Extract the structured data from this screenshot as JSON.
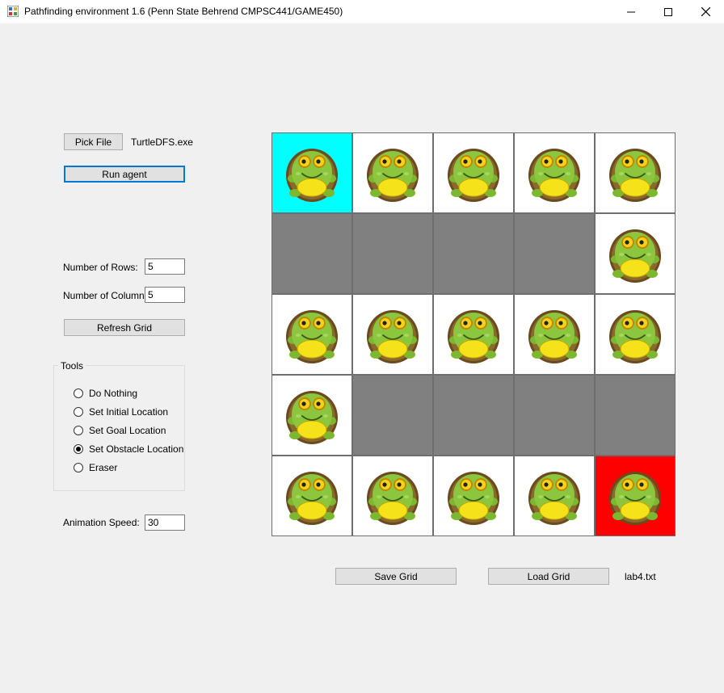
{
  "window": {
    "title": "Pathfinding environment 1.6 (Penn State Behrend CMPSC441/GAME450)"
  },
  "controls": {
    "pick_file_label": "Pick File",
    "file_name": "TurtleDFS.exe",
    "run_agent_label": "Run agent",
    "rows_label": "Number of Rows:",
    "rows_value": "5",
    "columns_label": "Number of Columns:",
    "columns_value": "5",
    "refresh_label": "Refresh Grid",
    "tools_title": "Tools",
    "tools": [
      {
        "label": "Do Nothing",
        "checked": false
      },
      {
        "label": "Set Initial Location",
        "checked": false
      },
      {
        "label": "Set Goal Location",
        "checked": false
      },
      {
        "label": "Set Obstacle Location",
        "checked": true
      },
      {
        "label": "Eraser",
        "checked": false
      }
    ],
    "speed_label": "Animation Speed:",
    "speed_value": "30",
    "save_label": "Save Grid",
    "load_label": "Load Grid",
    "loaded_file": "lab4.txt"
  },
  "grid": {
    "rows": 5,
    "cols": 5,
    "cells": [
      [
        "start-turtle",
        "turtle",
        "turtle",
        "turtle",
        "turtle"
      ],
      [
        "obstacle",
        "obstacle",
        "obstacle",
        "obstacle",
        "turtle"
      ],
      [
        "turtle",
        "turtle",
        "turtle",
        "turtle",
        "turtle"
      ],
      [
        "turtle",
        "obstacle",
        "obstacle",
        "obstacle",
        "obstacle"
      ],
      [
        "turtle",
        "turtle",
        "turtle",
        "turtle",
        "goal-turtle"
      ]
    ]
  },
  "colors": {
    "start": "#00ffff",
    "goal": "#ff0000",
    "obstacle": "#808080",
    "empty": "#ffffff"
  },
  "icons": {
    "agent": "turtle-icon",
    "app": "app-grid-icon"
  }
}
